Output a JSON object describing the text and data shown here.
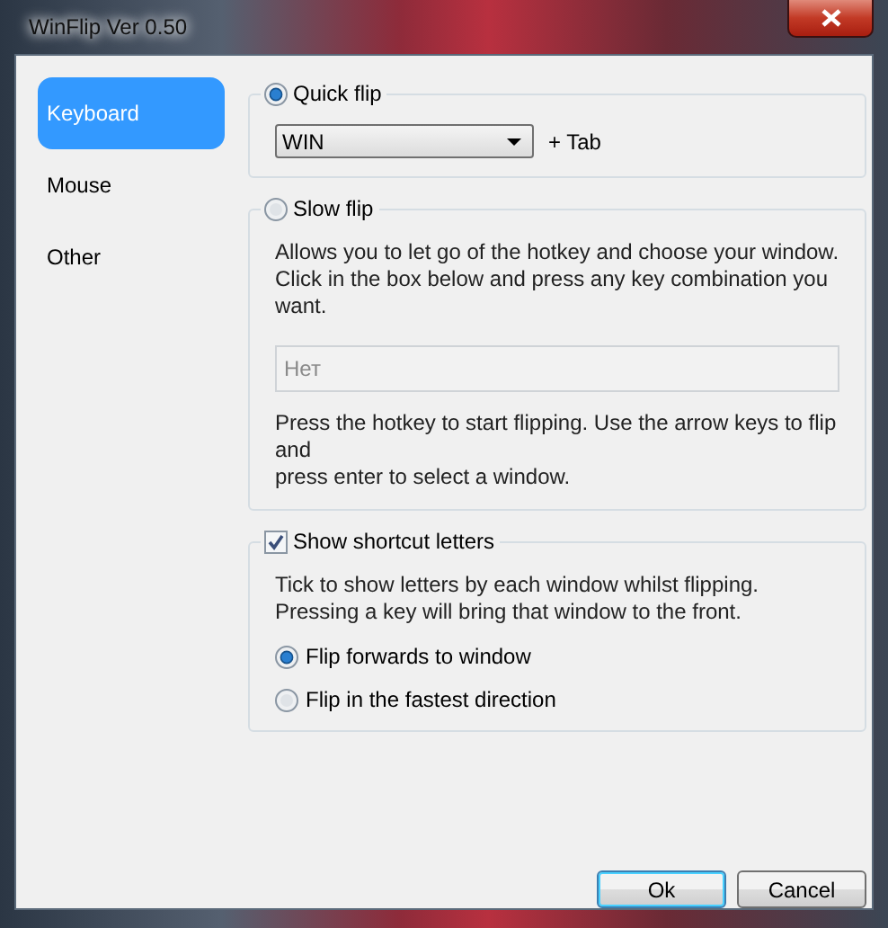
{
  "window": {
    "title": "WinFlip Ver 0.50"
  },
  "sidebar": {
    "items": [
      {
        "label": "Keyboard",
        "selected": true
      },
      {
        "label": "Mouse",
        "selected": false
      },
      {
        "label": "Other",
        "selected": false
      }
    ]
  },
  "quick_flip": {
    "label": "Quick flip",
    "selected": true,
    "hotkey": "WIN",
    "suffix": "+ Tab"
  },
  "slow_flip": {
    "label": "Slow flip",
    "selected": false,
    "description": "Allows you to let go of the hotkey and choose your window.\nClick in the box below and press any key combination you want.",
    "hotkey_field": {
      "value": "Нет",
      "disabled": true
    },
    "help": "Press the hotkey to start flipping. Use the arrow keys to flip and\npress enter to select a window."
  },
  "shortcut_letters": {
    "label": "Show shortcut letters",
    "checked": true,
    "description": "Tick to show letters by each window whilst flipping.\nPressing a key will bring that window to the front.",
    "options": [
      {
        "label": "Flip forwards to window",
        "selected": true
      },
      {
        "label": "Flip in the fastest direction",
        "selected": false
      }
    ]
  },
  "buttons": [
    {
      "label": "Ok",
      "default": true
    },
    {
      "label": "Cancel",
      "default": false
    }
  ]
}
